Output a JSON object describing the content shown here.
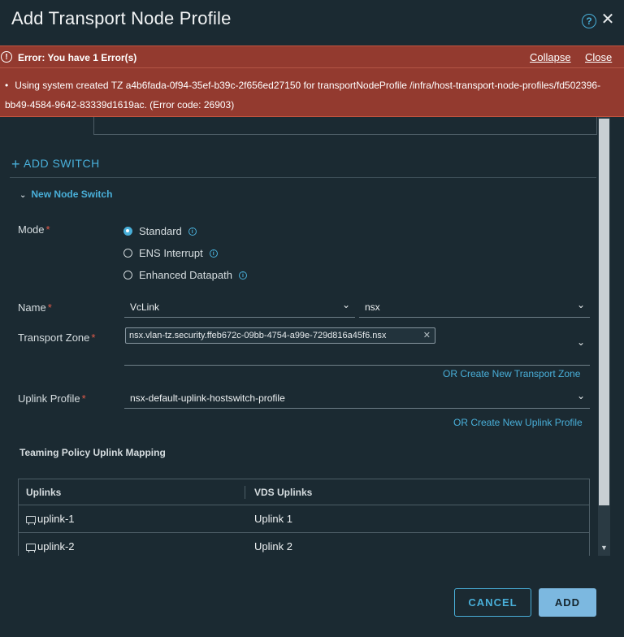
{
  "header": {
    "title": "Add Transport Node Profile",
    "help_glyph": "?",
    "close_glyph": "✕"
  },
  "error_banner": {
    "title": "Error: You have 1 Error(s)",
    "collapse_label": "Collapse",
    "close_label": "Close",
    "message": "Using system created TZ a4b6fada-0f94-35ef-b39c-2f656ed27150 for transportNodeProfile /infra/host-transport-node-profiles/fd502396-bb49-4584-9642-83339d1619ac. (Error code: 26903)"
  },
  "add_switch_label": "ADD SWITCH",
  "node_switch": {
    "title": "New Node Switch",
    "mode": {
      "label": "Mode",
      "options": [
        {
          "label": "Standard",
          "checked": true
        },
        {
          "label": "ENS Interrupt",
          "checked": false
        },
        {
          "label": "Enhanced Datapath",
          "checked": false
        }
      ]
    },
    "name": {
      "label": "Name",
      "vcenter_value": "VcLink",
      "switch_value": "nsx"
    },
    "transport_zone": {
      "label": "Transport Zone",
      "chip": "nsx.vlan-tz.security.ffeb672c-09bb-4754-a99e-729d816a45f6.nsx",
      "create_link": "OR Create New Transport Zone"
    },
    "uplink_profile": {
      "label": "Uplink Profile",
      "value": "nsx-default-uplink-hostswitch-profile",
      "create_link": "OR Create New Uplink Profile"
    },
    "teaming": {
      "title": "Teaming Policy Uplink Mapping",
      "columns": [
        "Uplinks",
        "VDS Uplinks"
      ],
      "rows": [
        {
          "uplink": "uplink-1",
          "vds": "Uplink 1"
        },
        {
          "uplink": "uplink-2",
          "vds": "Uplink 2"
        }
      ]
    }
  },
  "footer": {
    "cancel_label": "CANCEL",
    "add_label": "ADD"
  },
  "colors": {
    "accent": "#49afd9",
    "error_bg": "#933a2f",
    "background": "#1b2a32"
  }
}
